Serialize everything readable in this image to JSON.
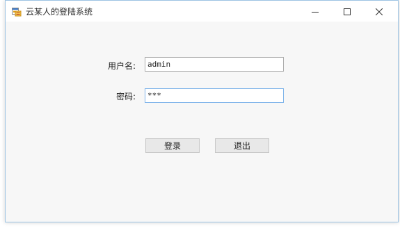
{
  "window": {
    "title": "云某人的登陆系统",
    "icon": "form-app-icon",
    "controls": [
      "minimize-icon",
      "maximize-icon",
      "close-icon"
    ]
  },
  "form": {
    "username_label": "用户名:",
    "username_value": "admin",
    "password_label": "密码:",
    "password_value": "***",
    "login_label": "登录",
    "exit_label": "退出"
  },
  "colors": {
    "client_bg": "#f7f7f7",
    "window_border": "#9cc3e3",
    "focused_input_border": "#7eb4ea"
  }
}
